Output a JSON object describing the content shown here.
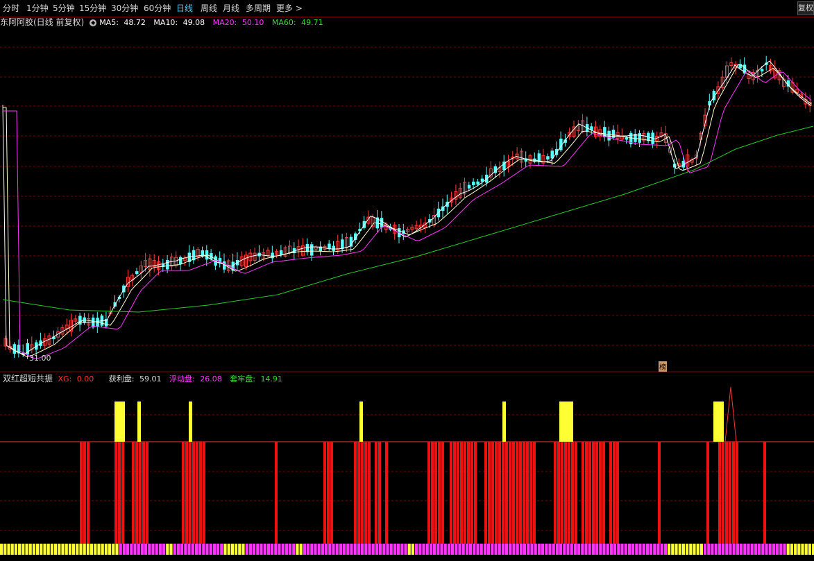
{
  "toolbar": {
    "periods": [
      "分时",
      "1分钟",
      "5分钟",
      "15分钟",
      "30分钟",
      "60分钟",
      "日线",
      "周线",
      "月线",
      "多周期",
      "更多 >"
    ],
    "active_period": "日线",
    "fuquan_label": "复权"
  },
  "main_legend": {
    "stock": "东阿阿胶(日线 前复权)",
    "ma5_label": "MA5:",
    "ma5": "48.72",
    "ma10_label": "MA10:",
    "ma10": "49.08",
    "ma20_label": "MA20:",
    "ma20": "50.10",
    "ma60_label": "MA60:",
    "ma60": "49.71"
  },
  "main_chart": {
    "low_price_label": "31.00",
    "marker_label": "榜"
  },
  "indicator_legend": {
    "name": "双红超短共振",
    "xg_label": "XG:",
    "xg": "0.00",
    "profit_label": "获利盘:",
    "profit": "59.01",
    "float_label": "浮动盘:",
    "float": "26.08",
    "locked_label": "套牢盘:",
    "locked": "14.91"
  },
  "colors": {
    "background": "#000000",
    "grid": "#7a0000",
    "up_candle": "#ff3c3c",
    "down_candle": "#54ffff",
    "ma5": "#ffffff",
    "ma10": "#ffff00",
    "ma20": "#ff33ff",
    "ma60": "#22cc22",
    "bar_red": "#ee1111",
    "bar_yellow": "#ffff33",
    "bar_magenta": "#ff33ff",
    "active_period": "#4ad0ff"
  }
}
